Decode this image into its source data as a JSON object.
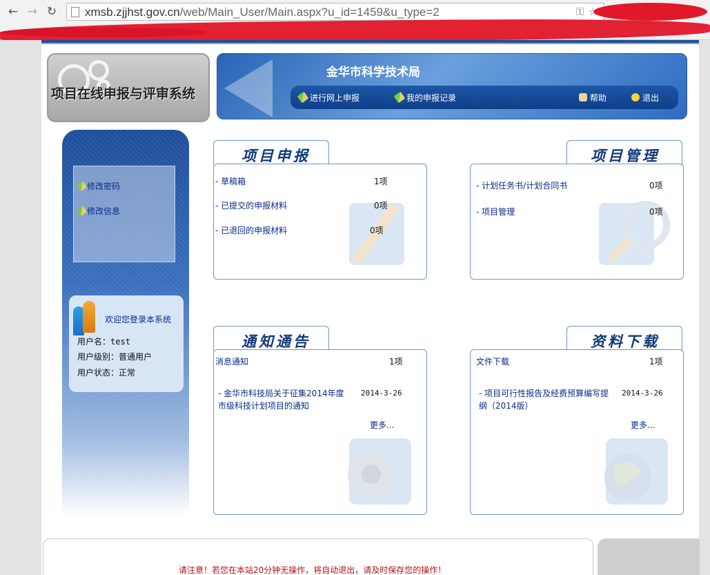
{
  "browser": {
    "back_icon": "back-arrow-icon",
    "forward_icon": "forward-arrow-icon",
    "reload_icon": "reload-icon",
    "url_host": "xmsb.zjjhst.gov.cn",
    "url_path": "/web/Main_User/Main.aspx?u_id=1459&u_type=2",
    "star_icon": "star-icon",
    "redaction_color": "#e1182a"
  },
  "header": {
    "logo_text": "项目在线申报与评审系统",
    "org_title": "金华市科学技术局",
    "nav": {
      "apply_online": "进行网上申报",
      "my_records": "我的申报记录",
      "help": "帮助",
      "logout": "退出"
    }
  },
  "sidebar": {
    "menu": [
      {
        "label": "修改密码"
      },
      {
        "label": "修改信息"
      }
    ],
    "user": {
      "welcome": "欢迎您登录本系统",
      "username_label": "用户名：",
      "username": "test",
      "level_label": "用户级别：",
      "level": "普通用户",
      "status_label": "用户状态：",
      "status": "正常"
    }
  },
  "panels": {
    "apply": {
      "title": "项目申报",
      "rows": [
        {
          "label": "- 草稿箱",
          "count": "1项"
        },
        {
          "label": "- 已提交的申报材料",
          "count": "0项"
        },
        {
          "label": "- 已退回的申报材料",
          "count": "0项"
        }
      ]
    },
    "manage": {
      "title": "项目管理",
      "rows": [
        {
          "label": "- 计划任务书/计划合同书",
          "count": "0项"
        },
        {
          "label": "- 项目管理",
          "count": "0项"
        }
      ]
    },
    "notice": {
      "title": "通知通告",
      "head_label": "消息通知",
      "head_count": "1项",
      "items": [
        {
          "title": "- 金华市科技局关于征集2014年度市级科技计划项目的通知",
          "date": "2014-3-26"
        }
      ],
      "more": "更多..."
    },
    "download": {
      "title": "资料下载",
      "head_label": "文件下载",
      "head_count": "1项",
      "items": [
        {
          "title": "- 项目可行性报告及经费预算编写提纲（2014版）",
          "date": "2014-3-26"
        }
      ],
      "more": "更多..."
    }
  },
  "footer": {
    "warning": "请注意！若您在本站20分钟无操作，将自动退出，请及时保存您的操作！"
  },
  "colors": {
    "brand_blue": "#1f4f9a",
    "link_blue": "#0a2a8a",
    "warning_red": "#b3121a"
  }
}
